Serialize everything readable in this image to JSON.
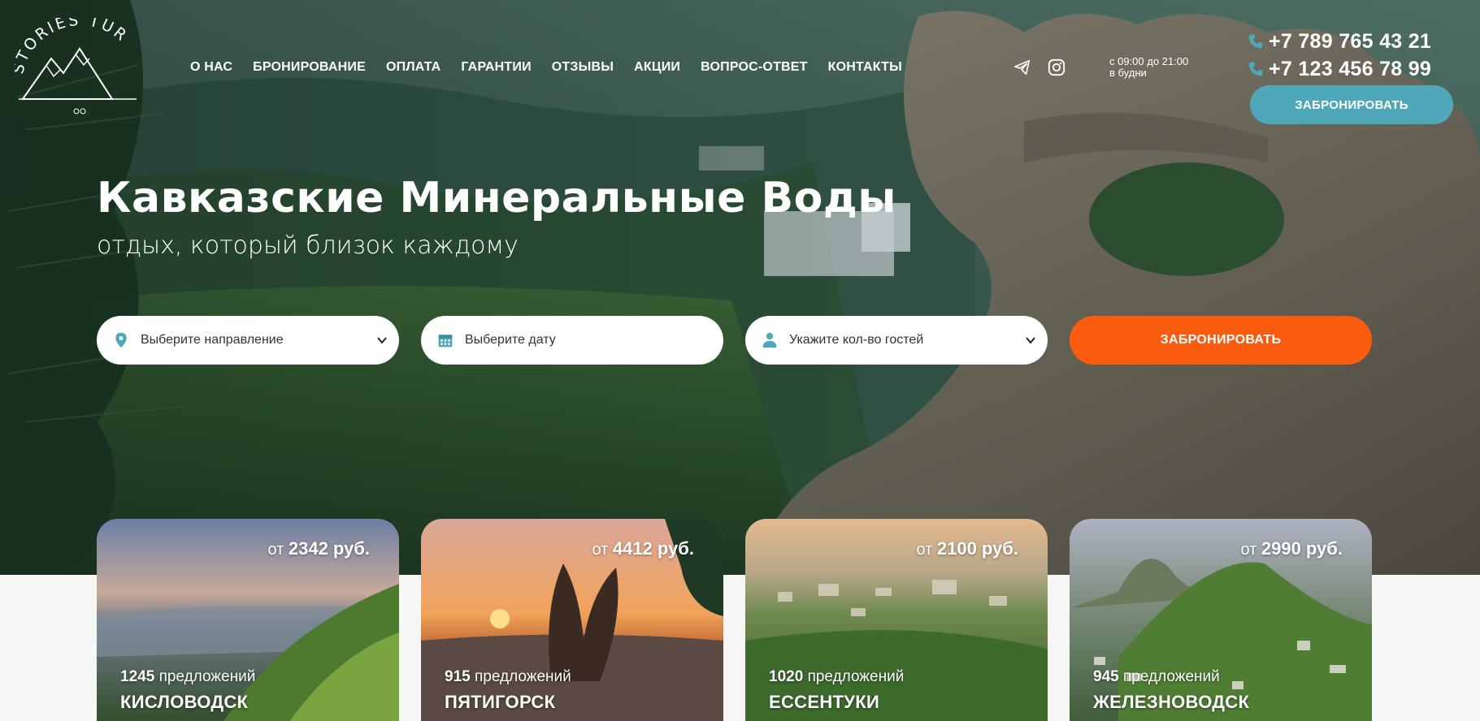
{
  "brand": {
    "logo_text": "STORIES TUR"
  },
  "nav": {
    "items": [
      {
        "label": "О НАС"
      },
      {
        "label": "БРОНИРОВАНИЕ"
      },
      {
        "label": "ОПЛАТА"
      },
      {
        "label": "ГАРАНТИИ"
      },
      {
        "label": "ОТЗЫВЫ"
      },
      {
        "label": "АКЦИИ"
      },
      {
        "label": "ВОПРОС-ОТВЕТ"
      },
      {
        "label": "КОНТАКТЫ"
      }
    ]
  },
  "social": {
    "icons": [
      "telegram-icon",
      "instagram-icon"
    ]
  },
  "hours": {
    "line1": "с 09:00 до 21:00",
    "line2": "в будни"
  },
  "phones": [
    "+7 789 765 43 21",
    "+7 123 456 78 99"
  ],
  "header_button": {
    "label": "ЗАБРОНИРОВАТЬ"
  },
  "hero": {
    "title": "Кавказские Минеральные Воды",
    "subtitle": "отдых, который близок каждому"
  },
  "search": {
    "direction_placeholder": "Выберите направление",
    "date_placeholder": "Выберите дату",
    "guests_placeholder": "Укажите кол-во гостей",
    "submit_label": "ЗАБРОНИРОВАТЬ"
  },
  "cards": [
    {
      "price_prefix": "от",
      "price": "2342 руб.",
      "offers_count": "1245",
      "offers_label": "предложений",
      "city": "КИСЛОВОДСК"
    },
    {
      "price_prefix": "от",
      "price": "4412 руб.",
      "offers_count": "915",
      "offers_label": "предложений",
      "city": "ПЯТИГОРСК"
    },
    {
      "price_prefix": "от",
      "price": "2100 руб.",
      "offers_count": "1020",
      "offers_label": "предложений",
      "city": "ЕССЕНТУКИ"
    },
    {
      "price_prefix": "от",
      "price": "2990 руб.",
      "offers_count": "945",
      "offers_label": "предложений",
      "city": "ЖЕЛЕЗНОВОДСК"
    }
  ],
  "colors": {
    "accent_teal": "#4ea8ba",
    "accent_orange": "#fb5b0f",
    "text_white": "#ffffff"
  }
}
